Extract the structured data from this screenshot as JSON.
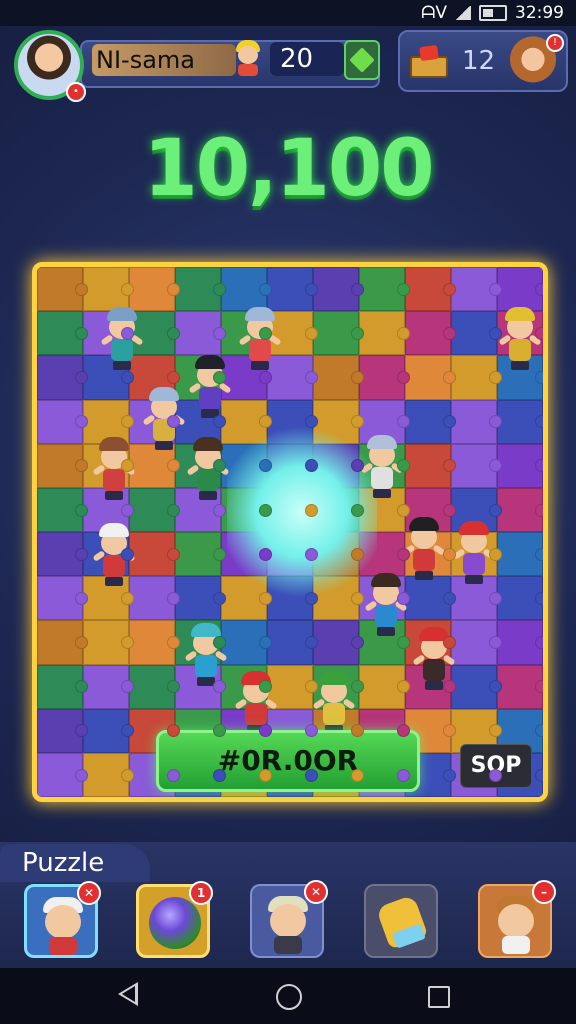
{
  "status_bar": {
    "time": "32:99",
    "network": "ᗩV"
  },
  "player": {
    "name": "NI-sama",
    "coins": "20",
    "notification": "•"
  },
  "shop": {
    "count": "12",
    "friend_badge": "!"
  },
  "score": "10,100",
  "board": {
    "palette": [
      "#c07a2a",
      "#3c4fb8",
      "#7a3bc8",
      "#2e8a57",
      "#c8483a",
      "#d29b2b",
      "#5a3fb0",
      "#b7357a",
      "#2a6fb8",
      "#8a5ad8",
      "#e0883a",
      "#3a9a4a"
    ]
  },
  "characters": [
    {
      "hat": "#7aa0c8",
      "shirt": "#2aa0a0"
    },
    {
      "hat": "#a0b8d8",
      "shirt": "#e04a4a"
    },
    {
      "hat": "#e0c030",
      "shirt": "#d8b030"
    },
    {
      "hat": "#202028",
      "shirt": "#6040c0"
    },
    {
      "hat": "#a0b8d8",
      "shirt": "#d8b040"
    },
    {
      "hat": "#8a5030",
      "shirt": "#d04040"
    },
    {
      "hat": "#4a3020",
      "shirt": "#2a8a4a"
    },
    {
      "hat": "#b0c0d8",
      "shirt": "#e0e0e0"
    },
    {
      "hat": "#f0f0f0",
      "shirt": "#d03a3a"
    },
    {
      "hat": "#202020",
      "shirt": "#d03a3a"
    },
    {
      "hat": "#d83030",
      "shirt": "#8a4ad0"
    },
    {
      "hat": "#3a2a20",
      "shirt": "#2a8ad0"
    },
    {
      "hat": "#40b8c8",
      "shirt": "#2aa0d0"
    },
    {
      "hat": "#d83030",
      "shirt": "#3a2a2a"
    },
    {
      "hat": "#d83030",
      "shirt": "#d03a3a"
    },
    {
      "hat": "#3aa03a",
      "shirt": "#e0c040"
    }
  ],
  "actions": {
    "primary_label": "#0R.0OR",
    "stop_label": "SOP"
  },
  "tray": {
    "title": "Puzzle",
    "items": [
      {
        "badge": "✕",
        "cap": "#f0f0f0",
        "shirt": "#d03a3a"
      },
      {
        "badge": "1"
      },
      {
        "badge": "✕",
        "cap": "#e0e0c0",
        "shirt": "#3a3a4a"
      },
      {
        "badge": ""
      },
      {
        "badge": "–",
        "cap": "#c07830",
        "shirt": "#f0f0f0"
      }
    ]
  }
}
